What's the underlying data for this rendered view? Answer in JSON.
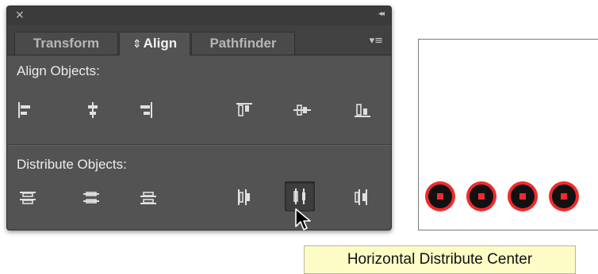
{
  "panel": {
    "close_glyph": "×",
    "collapse_glyph": "◂◂",
    "tabs": [
      {
        "label": "Transform",
        "active": false
      },
      {
        "label": "Align",
        "active": true,
        "prefix_glyph": "⌃⌄"
      },
      {
        "label": "Pathfinder",
        "active": false
      }
    ],
    "menu_glyph": "▾≡",
    "align_section": {
      "label": "Align Objects:",
      "icons": [
        "horizontal-align-left-icon",
        "horizontal-align-center-icon",
        "horizontal-align-right-icon",
        "vertical-align-top-icon",
        "vertical-align-center-icon",
        "vertical-align-bottom-icon"
      ]
    },
    "distribute_section": {
      "label": "Distribute Objects:",
      "icons": [
        "vertical-distribute-top-icon",
        "vertical-distribute-center-icon",
        "vertical-distribute-bottom-icon",
        "horizontal-distribute-left-icon",
        "horizontal-distribute-center-icon",
        "horizontal-distribute-right-icon"
      ],
      "pressed": "horizontal-distribute-center-icon"
    }
  },
  "tooltip": {
    "text": "Horizontal Distribute Center"
  },
  "canvas": {
    "objects": 4
  },
  "colors": {
    "panel_bg": "#535353",
    "tab_bar": "#414141",
    "tooltip_bg": "#fdfcc6",
    "dot_red": "#ef2b2b",
    "dot_black": "#111111"
  }
}
